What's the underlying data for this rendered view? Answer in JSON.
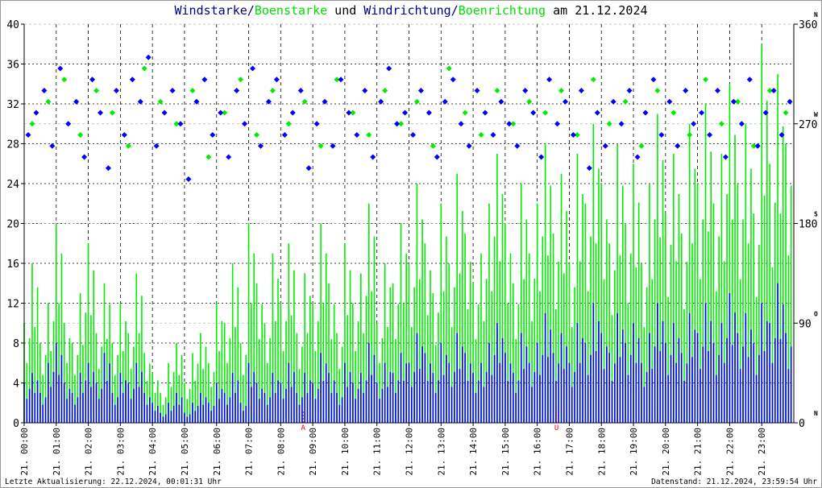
{
  "title": {
    "part1": "Windstarke",
    "sep1": "/",
    "part2": "Boenstarke",
    "mid": " und ",
    "part3": "Windrichtung",
    "sep2": "/",
    "part4": "Boenrichtung",
    "tail": " am 21.12.2024"
  },
  "footer": {
    "left": "Letzte Aktualisierung: 22.12.2024, 00:01:31 Uhr",
    "right": "Datenstand: 21.12.2024, 23:59:54 Uhr"
  },
  "colors": {
    "wind": "#0000ff",
    "gust": "#00ee00",
    "title_dark": "#000080",
    "grid": "#000000",
    "marker": "#ff0000"
  },
  "chart_data": {
    "type": "line",
    "title": "Windstarke/Boenstarke und Windrichtung/Boenrichtung am 21.12.2024",
    "x_unit": "hours of day",
    "x_tick_labels": [
      "21. 00:00",
      "21. 01:00",
      "21. 02:00",
      "21. 03:00",
      "21. 04:00",
      "21. 05:00",
      "21. 06:00",
      "21. 07:00",
      "21. 08:00",
      "21. 09:00",
      "21. 10:00",
      "21. 11:00",
      "21. 12:00",
      "21. 13:00",
      "21. 14:00",
      "21. 15:00",
      "21. 16:00",
      "21. 17:00",
      "21. 18:00",
      "21. 19:00",
      "21. 20:00",
      "21. 21:00",
      "21. 22:00",
      "21. 23:00"
    ],
    "xlim": [
      0,
      24
    ],
    "ylim_left": [
      0,
      40
    ],
    "y_left_ticks": [
      "0",
      "4",
      "8",
      "12",
      "16",
      "20",
      "24",
      "28",
      "32",
      "36",
      "40"
    ],
    "ylim_right": [
      0,
      360
    ],
    "y_right_ticks": [
      {
        "value": 0,
        "label": "0",
        "dir": "N"
      },
      {
        "value": 90,
        "label": "90",
        "dir": "O"
      },
      {
        "value": 180,
        "label": "180",
        "dir": "S"
      },
      {
        "value": 270,
        "label": "270",
        "dir": "W"
      },
      {
        "value": 360,
        "label": "360",
        "dir": "N"
      }
    ],
    "annotations": [
      {
        "label": "A",
        "hour": 8.7
      },
      {
        "label": "U",
        "hour": 16.6
      }
    ],
    "sample_interval_hours": 0.25,
    "series": [
      {
        "name": "Windstarke",
        "axis": "left",
        "style": "bars",
        "values": [
          4,
          5,
          3,
          6,
          8,
          4,
          3,
          5,
          6,
          4,
          7,
          3,
          5,
          4,
          6,
          3,
          2,
          1,
          2,
          3,
          1,
          2,
          3,
          2,
          4,
          3,
          5,
          2,
          6,
          4,
          3,
          5,
          4,
          6,
          3,
          5,
          4,
          7,
          5,
          3,
          6,
          4,
          5,
          8,
          4,
          6,
          5,
          7,
          6,
          9,
          7,
          5,
          8,
          6,
          9,
          7,
          5,
          6,
          8,
          10,
          7,
          5,
          9,
          6,
          8,
          11,
          7,
          9,
          6,
          10,
          8,
          12,
          9,
          7,
          11,
          8,
          10,
          6,
          9,
          12,
          8,
          10,
          7,
          11,
          9,
          12,
          8,
          10,
          13,
          9,
          11,
          8,
          12,
          10,
          14,
          9
        ]
      },
      {
        "name": "Boenstarke",
        "axis": "left",
        "style": "bars",
        "values": [
          10,
          16,
          8,
          12,
          20,
          10,
          8,
          13,
          18,
          9,
          14,
          8,
          12,
          9,
          15,
          7,
          5,
          3,
          6,
          8,
          4,
          7,
          9,
          6,
          12,
          10,
          16,
          8,
          20,
          14,
          10,
          17,
          12,
          18,
          9,
          15,
          12,
          20,
          14,
          9,
          18,
          12,
          15,
          22,
          10,
          16,
          14,
          20,
          16,
          24,
          18,
          13,
          22,
          16,
          25,
          19,
          14,
          17,
          22,
          27,
          20,
          14,
          24,
          17,
          22,
          28,
          19,
          25,
          16,
          27,
          22,
          30,
          24,
          18,
          28,
          20,
          26,
          16,
          24,
          31,
          21,
          27,
          19,
          30,
          24,
          32,
          22,
          27,
          34,
          24,
          30,
          21,
          38,
          26,
          35,
          28
        ]
      },
      {
        "name": "Windrichtung",
        "axis": "right",
        "style": "diamonds",
        "values": [
          260,
          280,
          300,
          250,
          320,
          270,
          290,
          240,
          310,
          280,
          230,
          300,
          260,
          310,
          290,
          330,
          250,
          280,
          300,
          270,
          220,
          290,
          310,
          260,
          280,
          240,
          300,
          270,
          320,
          250,
          290,
          310,
          260,
          280,
          300,
          230,
          270,
          290,
          250,
          310,
          280,
          260,
          300,
          240,
          290,
          320,
          270,
          280,
          260,
          300,
          280,
          240,
          290,
          310,
          270,
          250,
          300,
          280,
          260,
          290,
          270,
          250,
          300,
          280,
          240,
          310,
          270,
          290,
          260,
          300,
          230,
          280,
          250,
          290,
          270,
          300,
          240,
          280,
          310,
          260,
          290,
          250,
          300,
          270,
          280,
          260,
          300,
          240,
          290,
          270,
          310,
          250,
          280,
          300,
          260,
          290
        ]
      },
      {
        "name": "Boenrichtung",
        "axis": "right",
        "style": "diamonds",
        "values": [
          270,
          290,
          310,
          260,
          300,
          280,
          250,
          320,
          290,
          270,
          300,
          240,
          280,
          310,
          260,
          300,
          270,
          290,
          250,
          310,
          280,
          260,
          300,
          270,
          290,
          250,
          320,
          280,
          260,
          300,
          270,
          290,
          280,
          300,
          260,
          310,
          270,
          290,
          250,
          300,
          280,
          260,
          310,
          270,
          290,
          250,
          300,
          280
        ]
      }
    ]
  }
}
